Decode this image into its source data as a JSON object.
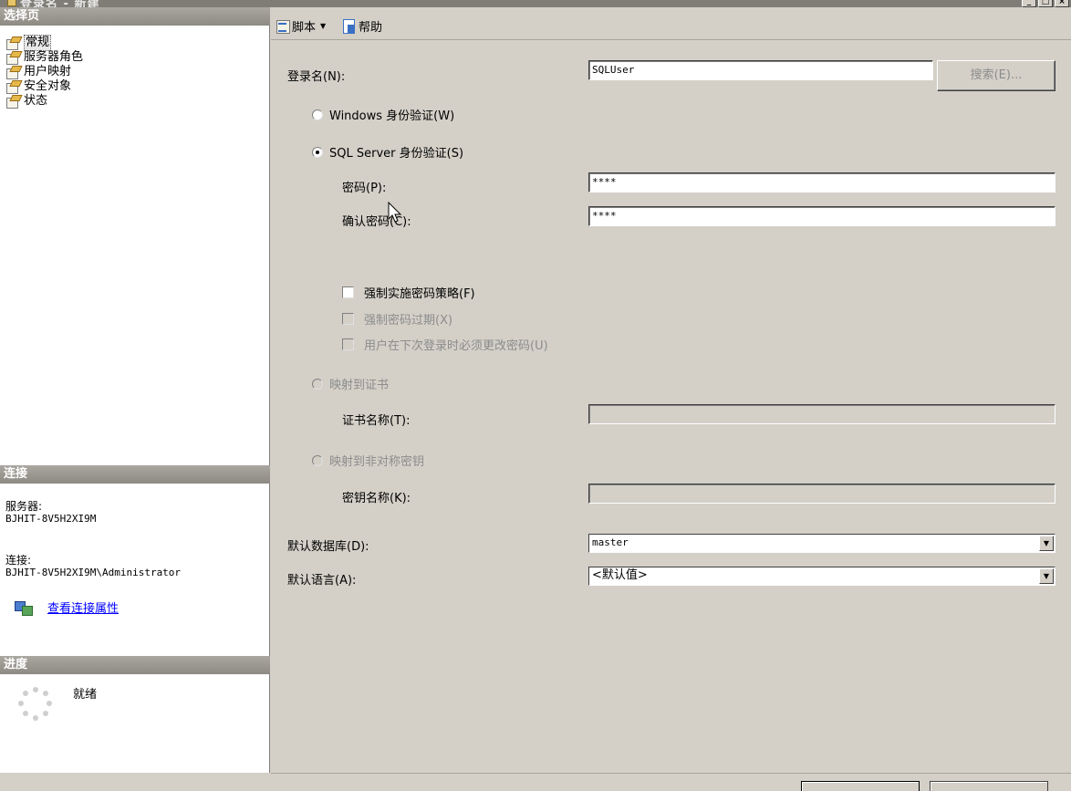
{
  "window": {
    "title": "登录名 - 新建"
  },
  "left": {
    "select_page_header": "选择页",
    "pages": [
      "常规",
      "服务器角色",
      "用户映射",
      "安全对象",
      "状态"
    ],
    "connection_header": "连接",
    "server_label": "服务器:",
    "server_value": "BJHIT-8V5H2XI9M",
    "connection_label": "连接:",
    "connection_value": "BJHIT-8V5H2XI9M\\Administrator",
    "view_props_link": "查看连接属性",
    "progress_header": "进度",
    "progress_status": "就绪"
  },
  "toolbar": {
    "script_label": "脚本",
    "help_label": "帮助"
  },
  "form": {
    "login_name_label": "登录名(N):",
    "login_name_value": "SQLUser",
    "search_button": "搜索(E)...",
    "windows_auth_label": "Windows 身份验证(W)",
    "sql_auth_label": "SQL Server 身份验证(S)",
    "password_label": "密码(P):",
    "password_value": "****",
    "confirm_password_label": "确认密码(C):",
    "confirm_password_value": "****",
    "enforce_policy_label": "强制实施密码策略(F)",
    "enforce_expiry_label": "强制密码过期(X)",
    "must_change_label": "用户在下次登录时必须更改密码(U)",
    "map_cert_label": "映射到证书",
    "cert_name_label": "证书名称(T):",
    "map_asym_label": "映射到非对称密钥",
    "key_name_label": "密钥名称(K):",
    "default_db_label": "默认数据库(D):",
    "default_db_value": "master",
    "default_lang_label": "默认语言(A):",
    "default_lang_value": "<默认值>"
  }
}
